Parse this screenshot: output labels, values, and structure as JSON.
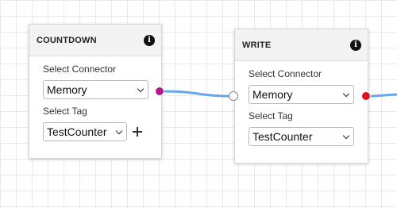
{
  "colors": {
    "wire": "#64a7ea",
    "output_port_countdown": "#b5198f",
    "output_port_write": "#d9141f",
    "input_port_border": "#888888"
  },
  "nodes": {
    "countdown": {
      "title": "COUNTDOWN",
      "connector_label": "Select Connector",
      "connector_value": "Memory",
      "tag_label": "Select Tag",
      "tag_value": "TestCounter",
      "info_icon": "info-icon",
      "add_icon": "plus-icon"
    },
    "write": {
      "title": "WRITE",
      "connector_label": "Select Connector",
      "connector_value": "Memory",
      "tag_label": "Select Tag",
      "tag_value": "TestCounter",
      "info_icon": "info-icon"
    }
  }
}
